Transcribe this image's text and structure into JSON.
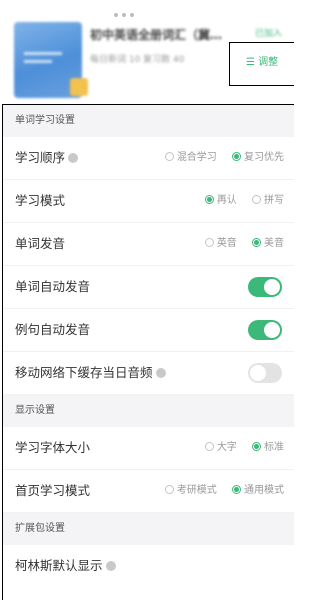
{
  "book": {
    "title": "初中英语全册词汇（冀…",
    "tag": "已加入",
    "meta": "每日新词 10   复习数 40",
    "adjust_label": "☰ 调整"
  },
  "sections": {
    "word_study": "单词学习设置",
    "display": "显示设置",
    "expansion": "扩展包设置"
  },
  "rows": {
    "order": {
      "label": "学习顺序",
      "opt1": "混合学习",
      "opt2": "复习优先",
      "selected": "复习优先"
    },
    "mode": {
      "label": "学习模式",
      "opt1": "再认",
      "opt2": "拼写",
      "selected": "再认"
    },
    "pronunciation": {
      "label": "单词发音",
      "opt1": "英音",
      "opt2": "美音",
      "selected": "美音"
    },
    "auto_word": {
      "label": "单词自动发音",
      "on": true
    },
    "auto_sentence": {
      "label": "例句自动发音",
      "on": true
    },
    "cache": {
      "label": "移动网络下缓存当日音频",
      "on": false
    },
    "font_size": {
      "label": "学习字体大小",
      "opt1": "大字",
      "opt2": "标准",
      "selected": "标准"
    },
    "home_mode": {
      "label": "首页学习模式",
      "opt1": "考研模式",
      "opt2": "通用模式",
      "selected": "通用模式"
    },
    "collins": {
      "label": "柯林斯默认显示"
    }
  },
  "colors": {
    "accent": "#3cb878",
    "section_bg": "#f4f4f6",
    "toggle_off": "#e3e3e3"
  }
}
